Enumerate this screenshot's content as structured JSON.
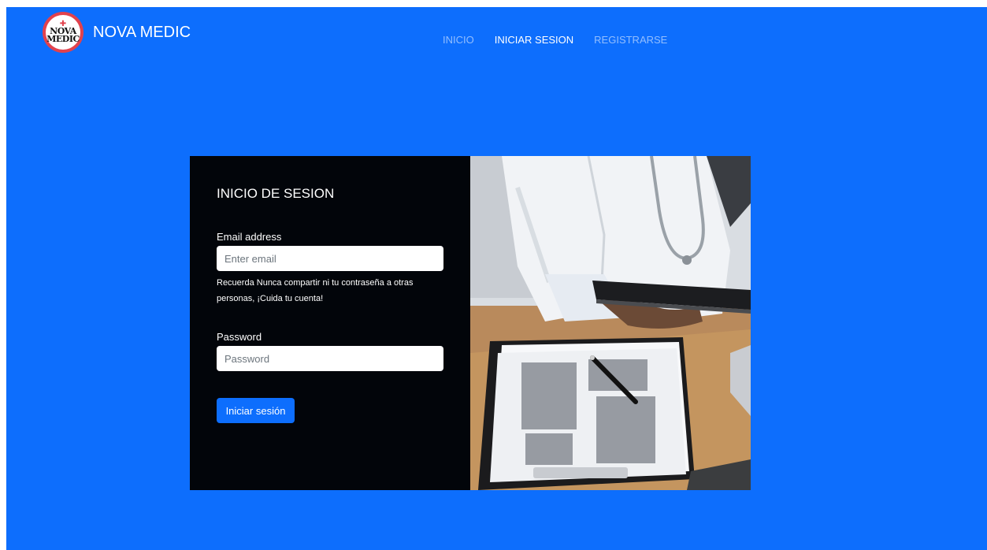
{
  "brand": {
    "name": "NOVA MEDIC",
    "logo_text_top": "NOVA",
    "logo_text_bottom": "MEDIC"
  },
  "nav": {
    "items": [
      {
        "label": "INICIO"
      },
      {
        "label": "INICIAR SESION"
      },
      {
        "label": "REGISTRARSE"
      }
    ]
  },
  "form": {
    "title": "INICIO DE SESION",
    "email_label": "Email address",
    "email_placeholder": "Enter email",
    "email_help": "Recuerda Nunca compartir ni tu contraseña a otras personas, ¡Cuida tu cuenta!",
    "password_label": "Password",
    "password_placeholder": "Password",
    "submit_label": "Iniciar sesión"
  },
  "colors": {
    "page_bg": "#0d6efd",
    "form_bg": "#02050a",
    "button_bg": "#0d6efd",
    "logo_ring": "#e1424d"
  },
  "icons": {
    "logo": "nova-medic-logo"
  }
}
